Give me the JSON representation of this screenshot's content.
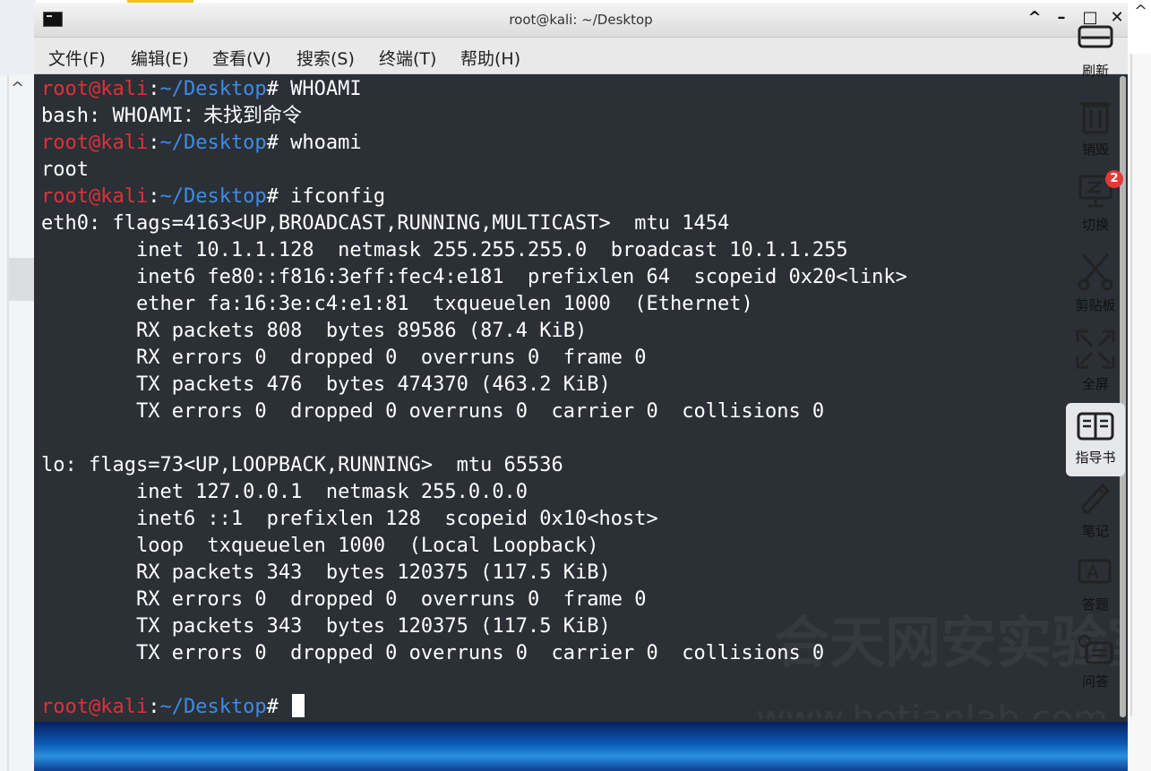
{
  "window": {
    "title": "root@kali: ~/Desktop",
    "controls": {
      "up": "^",
      "minimize": "–",
      "maximize": "□",
      "close": "✕"
    }
  },
  "menu": [
    "文件(F)",
    "编辑(E)",
    "查看(V)",
    "搜索(S)",
    "终端(T)",
    "帮助(H)"
  ],
  "prompt": {
    "user_host": "root@kali",
    "separator": ":",
    "path": "~/Desktop",
    "symbol": "#"
  },
  "terminal": {
    "cmd1": " WHOAMI",
    "out1": "bash: WHOAMI：未找到命令",
    "cmd2": " whoami",
    "out2": "root",
    "cmd3": " ifconfig",
    "eth0": [
      "eth0: flags=4163<UP,BROADCAST,RUNNING,MULTICAST>  mtu 1454",
      "        inet 10.1.1.128  netmask 255.255.255.0  broadcast 10.1.1.255",
      "        inet6 fe80::f816:3eff:fec4:e181  prefixlen 64  scopeid 0x20<link>",
      "        ether fa:16:3e:c4:e1:81  txqueuelen 1000  (Ethernet)",
      "        RX packets 808  bytes 89586 (87.4 KiB)",
      "        RX errors 0  dropped 0  overruns 0  frame 0",
      "        TX packets 476  bytes 474370 (463.2 KiB)",
      "        TX errors 0  dropped 0 overruns 0  carrier 0  collisions 0"
    ],
    "lo": [
      "lo: flags=73<UP,LOOPBACK,RUNNING>  mtu 65536",
      "        inet 127.0.0.1  netmask 255.0.0.0",
      "        inet6 ::1  prefixlen 128  scopeid 0x10<host>",
      "        loop  txqueuelen 1000  (Local Loopback)",
      "        RX packets 343  bytes 120375 (117.5 KiB)",
      "        RX errors 0  dropped 0  overruns 0  frame 0",
      "        TX packets 343  bytes 120375 (117.5 KiB)",
      "        TX errors 0  dropped 0 overruns 0  carrier 0  collisions 0"
    ]
  },
  "tools": [
    {
      "label": "刷新",
      "icon": "refresh-icon"
    },
    {
      "label": "销毁",
      "icon": "trash-icon"
    },
    {
      "label": "切换",
      "icon": "monitor-switch-icon",
      "badge": "2"
    },
    {
      "label": "剪贴板",
      "icon": "scissors-icon"
    },
    {
      "label": "全屏",
      "icon": "fullscreen-icon"
    },
    {
      "label": "指导书",
      "icon": "book-icon"
    },
    {
      "label": "笔记",
      "icon": "pencil-icon"
    },
    {
      "label": "答题",
      "icon": "answer-icon"
    },
    {
      "label": "问答",
      "icon": "qa-icon"
    }
  ],
  "colors": {
    "prompt_user": "#e0303a",
    "prompt_path": "#3f8be8",
    "terminal_bg": "#2a3035",
    "badge": "#e53935"
  }
}
